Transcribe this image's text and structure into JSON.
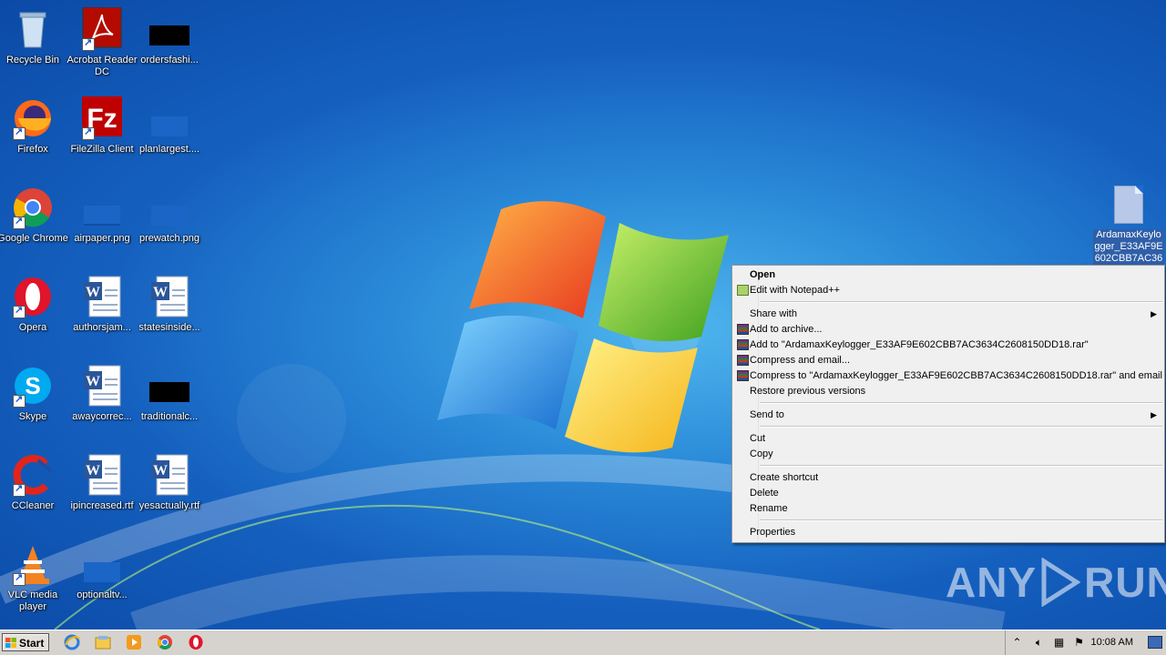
{
  "desktop_icons": [
    {
      "name": "recycle-bin",
      "label": "Recycle Bin"
    },
    {
      "name": "acrobat-reader",
      "label": "Acrobat Reader DC"
    },
    {
      "name": "ordersfashion",
      "label": "ordersfashi..."
    },
    {
      "name": "firefox",
      "label": "Firefox"
    },
    {
      "name": "filezilla",
      "label": "FileZilla Client"
    },
    {
      "name": "planlargest",
      "label": "planlargest...."
    },
    {
      "name": "google-chrome",
      "label": "Google Chrome"
    },
    {
      "name": "airpaper",
      "label": "airpaper.png"
    },
    {
      "name": "prewatch",
      "label": "prewatch.png"
    },
    {
      "name": "opera",
      "label": "Opera"
    },
    {
      "name": "authorsjam",
      "label": "authorsjam..."
    },
    {
      "name": "statesinside",
      "label": "statesinside..."
    },
    {
      "name": "skype",
      "label": "Skype"
    },
    {
      "name": "awaycorrect",
      "label": "awaycorrec..."
    },
    {
      "name": "traditional",
      "label": "traditionalc..."
    },
    {
      "name": "ccleaner",
      "label": "CCleaner"
    },
    {
      "name": "ipincreased",
      "label": "ipincreased.rtf"
    },
    {
      "name": "yesactually",
      "label": "yesactually.rtf"
    },
    {
      "name": "vlc",
      "label": "VLC media player"
    },
    {
      "name": "optionaltv",
      "label": "optionaltv..."
    }
  ],
  "selected_file": {
    "label": "ArdamaxKeylogger_E33AF9E602CBB7AC36"
  },
  "context_menu": {
    "open": "Open",
    "edit_notepad": "Edit with Notepad++",
    "share_with": "Share with",
    "add_archive": "Add to archive...",
    "add_to_rar": "Add to \"ArdamaxKeylogger_E33AF9E602CBB7AC3634C2608150DD18.rar\"",
    "compress_email": "Compress and email...",
    "compress_to_rar_email": "Compress to \"ArdamaxKeylogger_E33AF9E602CBB7AC3634C2608150DD18.rar\" and email",
    "restore_versions": "Restore previous versions",
    "send_to": "Send to",
    "cut": "Cut",
    "copy": "Copy",
    "create_shortcut": "Create shortcut",
    "delete": "Delete",
    "rename": "Rename",
    "properties": "Properties"
  },
  "watermark": {
    "left": "ANY",
    "right": "RUN"
  },
  "taskbar": {
    "start_label": "Start",
    "quick_launch": [
      "internet-explorer-icon",
      "explorer-folder-icon",
      "media-player-icon",
      "chrome-icon",
      "opera-icon"
    ],
    "clock": "10:08 AM"
  }
}
